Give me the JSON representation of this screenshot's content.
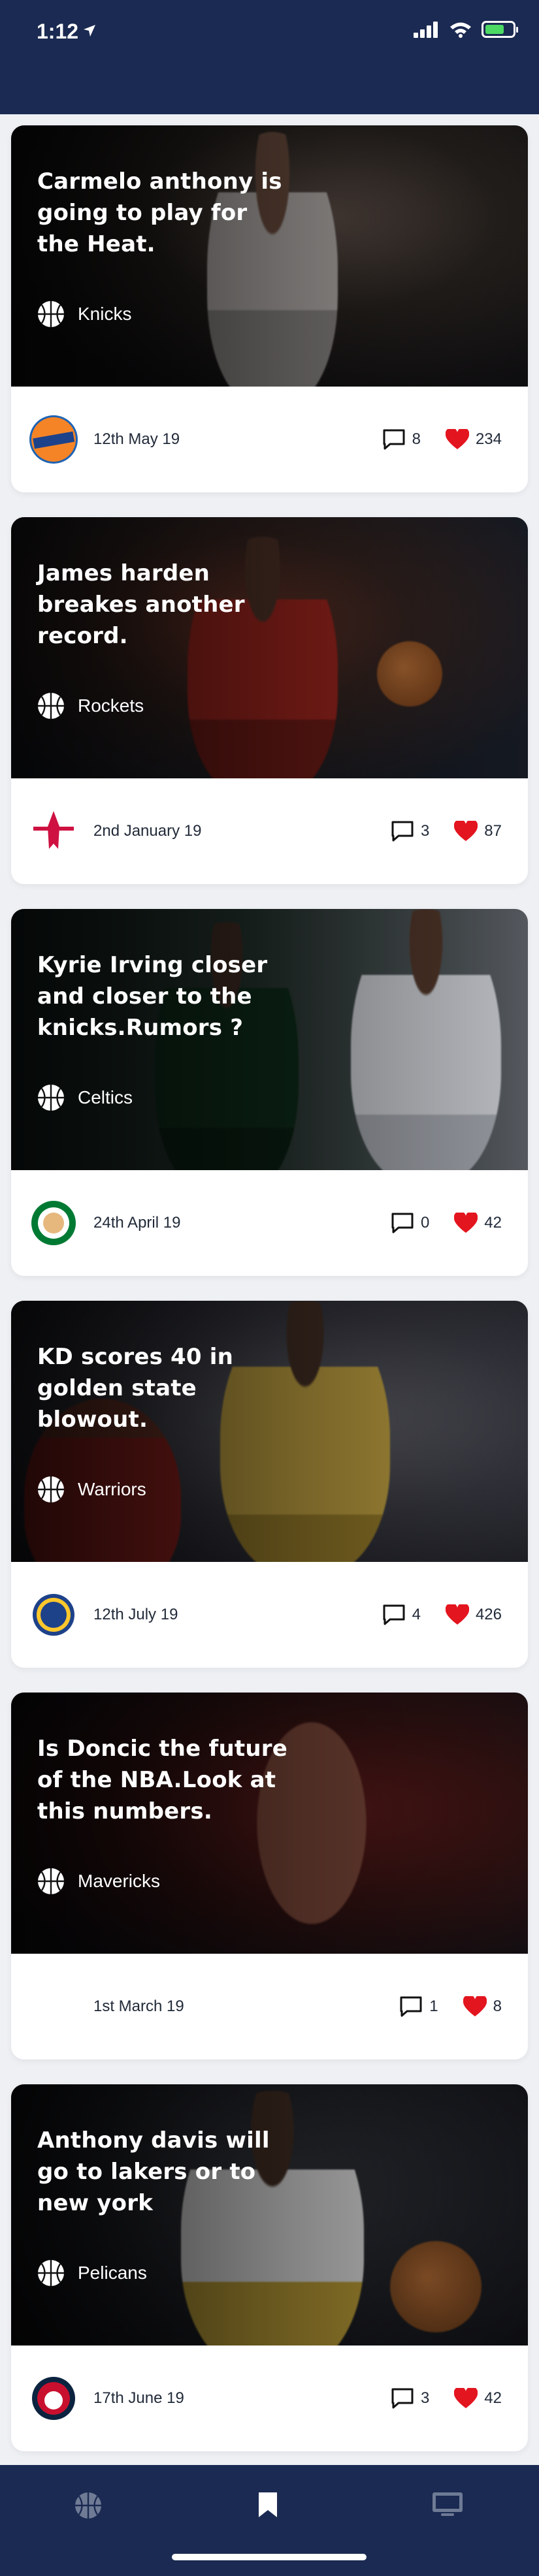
{
  "status": {
    "time": "1:12",
    "battery_color": "#4cd964"
  },
  "colors": {
    "header": "#1b2a52",
    "heart": "#e3151f",
    "text": "#222b3a"
  },
  "cards": [
    {
      "headline": "Carmelo anthony is going to play for the Heat.",
      "team": "Knicks",
      "date": "12th May 19",
      "comments": "8",
      "likes": "234",
      "team_icon": "knicks-logo-icon"
    },
    {
      "headline": "James harden breakes another record.",
      "team": "Rockets",
      "date": "2nd January 19",
      "comments": "3",
      "likes": "87",
      "team_icon": "rockets-logo-icon"
    },
    {
      "headline": "Kyrie Irving closer and closer to the knicks.Rumors ?",
      "team": "Celtics",
      "date": "24th April 19",
      "comments": "0",
      "likes": "42",
      "team_icon": "celtics-logo-icon"
    },
    {
      "headline": "KD scores 40 in golden state blowout.",
      "team": "Warriors",
      "date": "12th July 19",
      "comments": "4",
      "likes": "426",
      "team_icon": "warriors-logo-icon"
    },
    {
      "headline": "Is Doncic the future of the NBA.Look at this numbers.",
      "team": "Mavericks",
      "date": "1st March 19",
      "comments": "1",
      "likes": "8",
      "team_icon": "mavericks-logo-icon"
    },
    {
      "headline": "Anthony davis will go to lakers or to new york",
      "team": "Pelicans",
      "date": "17th June 19",
      "comments": "3",
      "likes": "42",
      "team_icon": "pelicans-logo-icon"
    }
  ],
  "nav": {
    "items": [
      "basketball-icon",
      "bookmark-icon",
      "tv-icon"
    ],
    "active": "bookmark-icon"
  }
}
